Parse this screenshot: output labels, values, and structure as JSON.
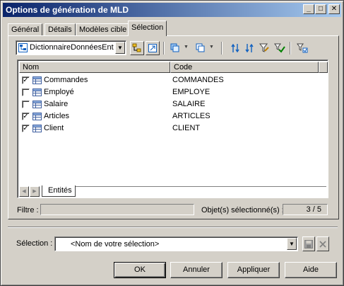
{
  "window": {
    "title": "Options de génération de MLD",
    "minimize_glyph": "_",
    "maximize_glyph": "□",
    "close_glyph": "✕"
  },
  "tabs": [
    {
      "label": "Général"
    },
    {
      "label": "Détails"
    },
    {
      "label": "Modèles cible"
    },
    {
      "label": "Sélection"
    }
  ],
  "toolbar": {
    "model_combo_value": "DictionnaireDonnéesEnt",
    "icons": [
      "hierarchy-icon",
      "include-submodels-icon",
      "select-all-icon",
      "deselect-all-icon",
      "move-top-icon",
      "move-bottom-icon",
      "filter-edit-icon",
      "select-all-checked-icon",
      "use-filter-icon"
    ]
  },
  "grid": {
    "columns": [
      "Nom",
      "Code"
    ],
    "rows": [
      {
        "name": "Commandes",
        "code": "COMMANDES",
        "checked": true,
        "check_glyph": "✓"
      },
      {
        "name": "Employé",
        "code": "EMPLOYE",
        "checked": false,
        "check_glyph": ""
      },
      {
        "name": "Salaire",
        "code": "SALAIRE",
        "checked": false,
        "check_glyph": ""
      },
      {
        "name": "Articles",
        "code": "ARTICLES",
        "checked": true,
        "check_glyph": "✓"
      },
      {
        "name": "Client",
        "code": "CLIENT",
        "checked": true,
        "check_glyph": "✓"
      }
    ],
    "sheet_tab": "Entités",
    "scroll_left_glyph": "◀",
    "scroll_right_glyph": "▶"
  },
  "filter": {
    "label": "Filtre :",
    "value": ""
  },
  "selected_objects": {
    "label": "Objet(s) sélectionné(s) :",
    "value": "3 / 5"
  },
  "selection": {
    "label": "Sélection :",
    "placeholder": "<Nom de votre sélection>"
  },
  "buttons": {
    "ok": "OK",
    "cancel": "Annuler",
    "apply": "Appliquer",
    "help": "Aide"
  },
  "colors": {
    "title_gradient_start": "#0a246a",
    "title_gradient_end": "#a6caf0",
    "face": "#d4d0c8"
  }
}
